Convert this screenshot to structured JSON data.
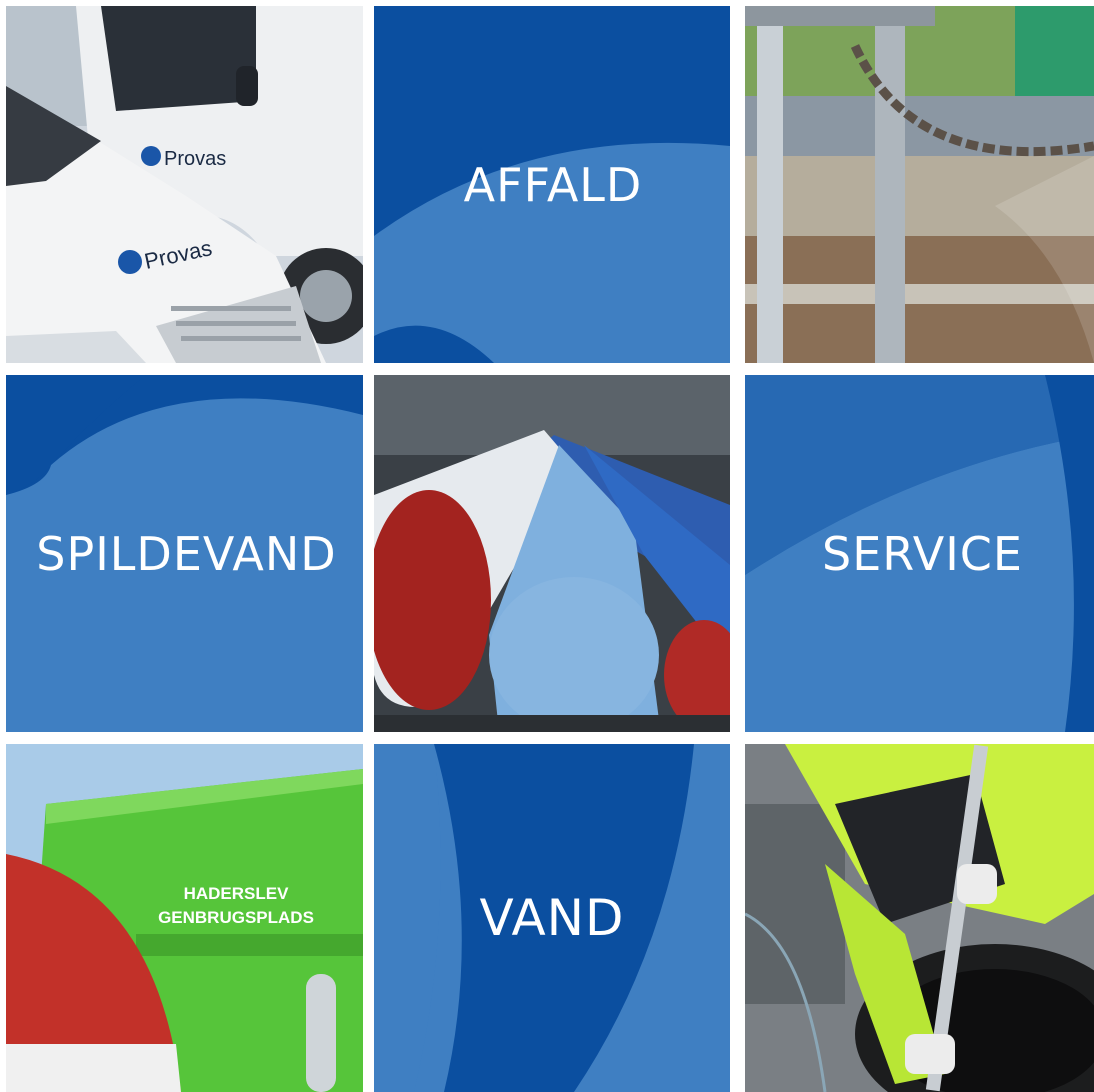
{
  "colors": {
    "blue_dark": "#0b4fa0",
    "blue_light": "#3f7fc2",
    "white": "#ffffff",
    "van_white": "#e9ecef",
    "container_green": "#56c53a",
    "pipe_blue": "#7fb0de",
    "pipe_red": "#a3231f",
    "hi_vis_yellow": "#c9f040"
  },
  "tiles": [
    {
      "id": "vans",
      "type": "photo",
      "icon": "vans-photo",
      "logo_text": "Provas",
      "logo_text_2": "Provas"
    },
    {
      "id": "affald",
      "type": "label",
      "label": "AFFALD"
    },
    {
      "id": "treatment-plant",
      "type": "photo",
      "icon": "chain-railing-photo"
    },
    {
      "id": "spildevand",
      "type": "label",
      "label": "SPILDEVAND"
    },
    {
      "id": "pipes",
      "type": "photo",
      "icon": "pipes-photo"
    },
    {
      "id": "service",
      "type": "label",
      "label": "SERVICE"
    },
    {
      "id": "recycling",
      "type": "photo",
      "icon": "recycling-container-photo",
      "sign_line_1": "HADERSLEV",
      "sign_line_2": "GENBRUGSPLADS"
    },
    {
      "id": "vand",
      "type": "label",
      "label": "VAND"
    },
    {
      "id": "manhole-worker",
      "type": "photo",
      "icon": "manhole-worker-photo"
    }
  ]
}
